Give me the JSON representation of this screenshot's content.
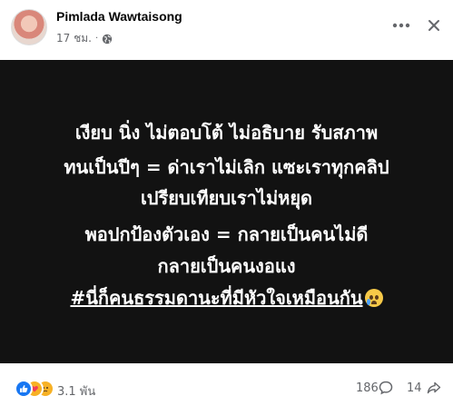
{
  "post": {
    "author": "Pimlada Wawtaisong",
    "time": "17 ชม.",
    "separator": "·",
    "icons": {
      "privacy": "globe-icon",
      "more": "more-dots-icon",
      "close": "close-icon"
    },
    "background_color": "#121212",
    "lines": [
      "เงียบ นิ่ง ไม่ตอบโต้ ไม่อธิบาย รับสภาพ",
      "ทนเป็นปีๆ = ด่าเราไม่เลิก แซะเราทุกคลิป",
      "เปรียบเทียบเราไม่หยุด",
      "พอปกป้องตัวเอง = กลายเป็นคนไม่ดี",
      "กลายเป็นคนงอแง"
    ],
    "hashtag": "#นี่ก็คนธรรมดานะที่มีหัวใจเหมือนกัน",
    "emoji": "crying-face-emoji"
  },
  "footer": {
    "reactions": [
      "like",
      "care",
      "sad"
    ],
    "reaction_count": "3.1 พัน",
    "comment_count": "186",
    "share_count": "14",
    "icons": {
      "comment": "comment-icon",
      "share": "share-icon"
    },
    "accent": "#1877f2"
  }
}
